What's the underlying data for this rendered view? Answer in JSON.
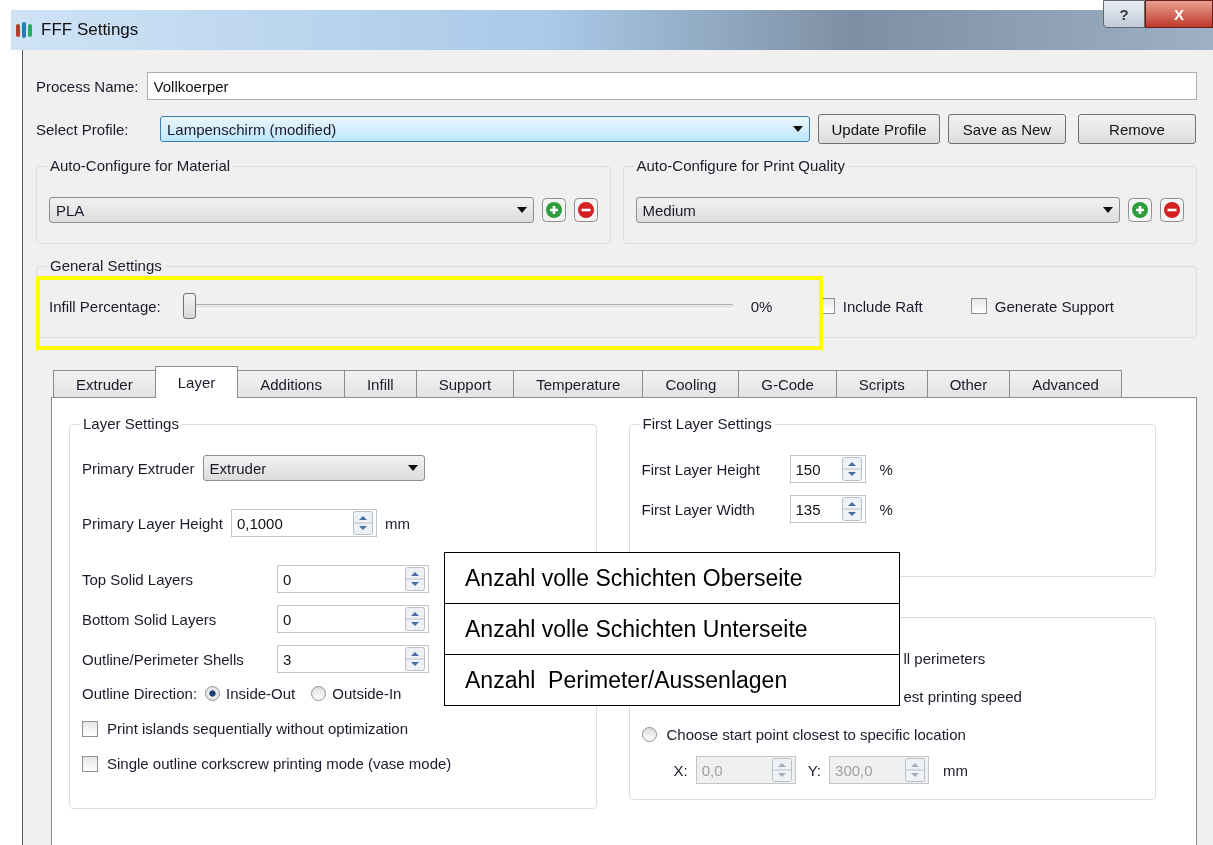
{
  "window": {
    "title": "FFF Settings",
    "buttons": [
      "?",
      "X"
    ]
  },
  "process_name": {
    "label": "Process Name:",
    "value": "Vollkoerper"
  },
  "profile": {
    "label": "Select Profile:",
    "value": "Lampenschirm (modified)",
    "buttons": [
      "Update Profile",
      "Save as New",
      "Remove"
    ]
  },
  "auto_configure": [
    {
      "title": "Auto-Configure for Material",
      "value": "PLA"
    },
    {
      "title": "Auto-Configure for Print Quality",
      "value": "Medium"
    }
  ],
  "general": {
    "title": "General Settings",
    "infill_label": "Infill Percentage:",
    "level": 0,
    "reading": "0%",
    "checks": [
      {
        "label": "Include Raft",
        "checked": false
      },
      {
        "label": "Generate Support",
        "checked": false
      }
    ]
  },
  "tabs": [
    {
      "label": "Extruder",
      "selected": false
    },
    {
      "label": "Layer",
      "selected": true
    },
    {
      "label": "Additions",
      "selected": false
    },
    {
      "label": "Infill",
      "selected": false
    },
    {
      "label": "Support",
      "selected": false
    },
    {
      "label": "Temperature",
      "selected": false
    },
    {
      "label": "Cooling",
      "selected": false
    },
    {
      "label": "G-Code",
      "selected": false
    },
    {
      "label": "Scripts",
      "selected": false
    },
    {
      "label": "Other",
      "selected": false
    },
    {
      "label": "Advanced",
      "selected": false
    }
  ],
  "layer_settings": {
    "title": "Layer Settings",
    "primary_extruder": {
      "label": "Primary Extruder",
      "value": "Extruder"
    },
    "layer_height": {
      "label": "Primary Layer Height",
      "value": "0,1000",
      "unit": "mm"
    },
    "spins": [
      {
        "label": "Top Solid Layers",
        "value": "0"
      },
      {
        "label": "Bottom Solid Layers",
        "value": "0"
      },
      {
        "label": "Outline/Perimeter Shells",
        "value": "3"
      }
    ],
    "outline_direction": {
      "label": "Outline Direction:",
      "options": [
        {
          "label": "Inside-Out",
          "selected": true
        },
        {
          "label": "Outside-In",
          "selected": false
        }
      ]
    },
    "checks": [
      {
        "label": "Print islands sequentially without optimization",
        "checked": false
      },
      {
        "label": "Single outline corkscrew printing mode (vase mode)",
        "checked": false
      }
    ]
  },
  "first_layer": {
    "title": "First Layer Settings",
    "rows": [
      {
        "label": "First Layer Height",
        "value": "150",
        "unit": "%"
      },
      {
        "label": "First Layer Width",
        "value": "135",
        "unit": "%"
      }
    ]
  },
  "start_points": {
    "options": [
      {
        "kind": "text",
        "label": "ll perimeters"
      },
      {
        "kind": "text",
        "label": "est printing speed"
      },
      {
        "kind": "radio",
        "label": "Choose start point closest to specific location",
        "selected": false
      }
    ],
    "x_label": "X:",
    "x_value": "0,0",
    "y_label": "Y:",
    "y_value": "300,0",
    "unit": "mm",
    "disabled": true
  },
  "callouts": [
    "Anzahl volle Schichten Oberseite",
    "Anzahl volle Schichten Unterseite",
    "Anzahl  Perimeter/Aussenlagen"
  ]
}
